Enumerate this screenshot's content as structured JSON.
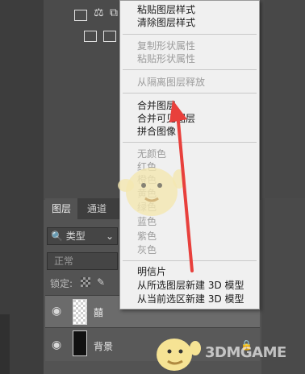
{
  "menu": {
    "items_top": [
      "粘贴图层样式",
      "清除图层样式"
    ],
    "items_shape": [
      "复制形状属性",
      "粘贴形状属性"
    ],
    "items_release": [
      "从隔离图层释放"
    ],
    "items_merge": [
      "合并图层",
      "合并可见图层",
      "拼合图像"
    ],
    "items_colors": [
      "无颜色",
      "红色",
      "橙色",
      "黄色",
      "绿色",
      "蓝色",
      "紫色",
      "灰色"
    ],
    "items_bottom": [
      "明信片",
      "从所选图层新建 3D 模型",
      "从当前选区新建 3D 模型"
    ]
  },
  "panel": {
    "tabs": [
      "图层",
      "通道"
    ],
    "filter_label": "类型",
    "blend_mode": "正常",
    "lock_label": "锁定:",
    "layers": [
      {
        "name": "囍",
        "visible": true
      },
      {
        "name": "背景",
        "visible": true,
        "locked": true
      }
    ]
  },
  "watermark": "3DMGAME",
  "colors": {
    "arrow": "#e8403c",
    "menu_bg": "#f0f0f0",
    "panel_bg": "#535353"
  }
}
